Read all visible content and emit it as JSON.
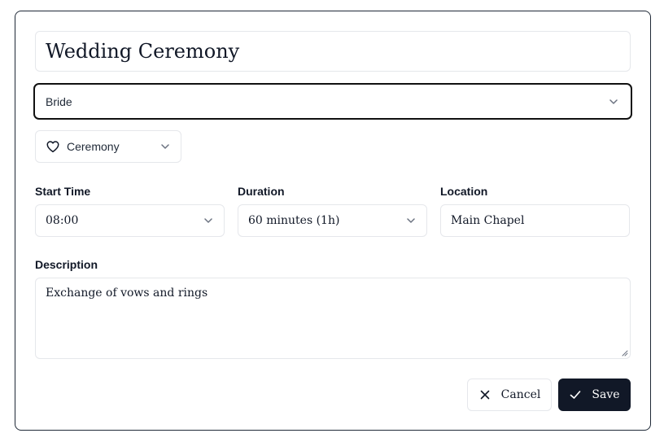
{
  "event": {
    "title": "Wedding Ceremony",
    "role": "Bride",
    "category": "Ceremony",
    "category_icon": "heart-icon"
  },
  "fields": {
    "start_time": {
      "label": "Start Time",
      "value": "08:00"
    },
    "duration": {
      "label": "Duration",
      "value": "60 minutes (1h)"
    },
    "location": {
      "label": "Location",
      "value": "Main Chapel"
    },
    "description": {
      "label": "Description",
      "value": "Exchange of vows and rings"
    }
  },
  "actions": {
    "cancel_label": "Cancel",
    "save_label": "Save"
  },
  "colors": {
    "primary": "#111827",
    "border": "#e5e7eb",
    "focus_ring": "#111111"
  }
}
